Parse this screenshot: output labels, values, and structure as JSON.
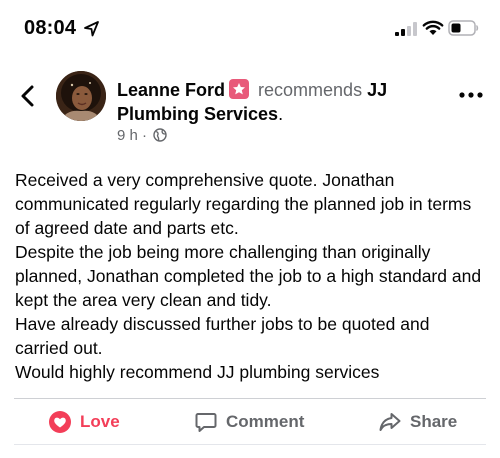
{
  "status_bar": {
    "time": "08:04",
    "icons": [
      "location-arrow-icon",
      "signal-icon",
      "wifi-icon",
      "battery-icon"
    ]
  },
  "header": {
    "author": "Leanne Ford",
    "verb": "recommends",
    "page_name": "JJ Plumbing Services",
    "page_suffix": ".",
    "time_ago": "9 h",
    "separator": "·",
    "audience_icon": "globe-icon",
    "badge_icon": "star-badge-icon"
  },
  "post": {
    "paragraphs": [
      "Received a very comprehensive quote. Jonathan communicated regularly regarding the planned job in terms of agreed date and parts etc.",
      "Despite the job being more challenging than originally planned, Jonathan completed the job to a high standard and kept the area very clean and tidy.",
      "Have already discussed further jobs to be quoted and carried out.",
      "Would highly recommend JJ plumbing services"
    ]
  },
  "actions": {
    "love_label": "Love",
    "comment_label": "Comment",
    "share_label": "Share"
  },
  "colors": {
    "love": "#f33e58",
    "secondary_text": "#65676b",
    "badge": "#e85a7a"
  }
}
